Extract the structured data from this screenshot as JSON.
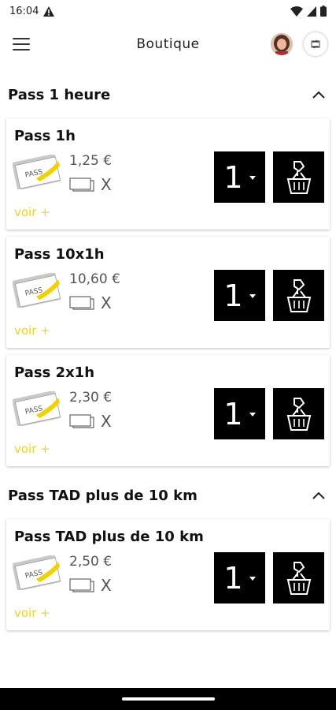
{
  "status_bar": {
    "time": "16:04"
  },
  "app_bar": {
    "title": "Boutique"
  },
  "sections": [
    {
      "title": "Pass 1 heure",
      "cards": [
        {
          "title": "Pass 1h",
          "price": "1,25 €",
          "qty_mult": "X",
          "voir": "voir +",
          "quantity": "1"
        },
        {
          "title": "Pass 10x1h",
          "price": "10,60 €",
          "qty_mult": "X",
          "voir": "voir +",
          "quantity": "1"
        },
        {
          "title": "Pass 2x1h",
          "price": "2,30 €",
          "qty_mult": "X",
          "voir": "voir +",
          "quantity": "1"
        }
      ]
    },
    {
      "title": "Pass TAD plus de 10 km",
      "cards": [
        {
          "title": "Pass TAD plus de 10 km",
          "price": "2,50 €",
          "qty_mult": "X",
          "voir": "voir +",
          "quantity": "1"
        }
      ]
    }
  ],
  "pass_image_label": "PASS",
  "colors": {
    "accent": "#f0d21a",
    "button_bg": "#000000",
    "text": "#111111"
  },
  "icons": {
    "warning": "warning-icon",
    "wifi": "wifi-icon",
    "signal": "signal-icon",
    "battery": "battery-icon",
    "menu": "hamburger-menu-icon",
    "sync": "sync-icon",
    "chevron_up": "chevron-up-icon",
    "ticket": "ticket-icon",
    "cart": "basket-add-icon"
  }
}
